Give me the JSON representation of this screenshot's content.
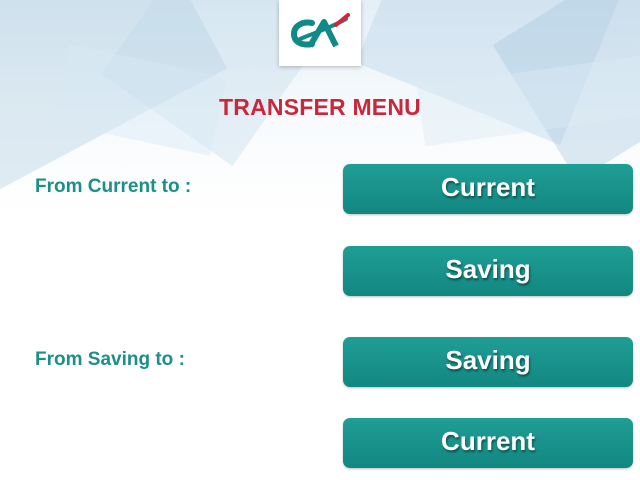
{
  "header": {
    "logo_name": "credit-agricole-logo",
    "title": "TRANSFER MENU"
  },
  "colors": {
    "accent_teal": "#1b8f88",
    "title_red": "#c8283c",
    "button_teal": "#1a958d"
  },
  "sections": [
    {
      "label": "From Current to :",
      "buttons": [
        "Current",
        "Saving"
      ]
    },
    {
      "label": "From Saving to :",
      "buttons": [
        "Saving",
        "Current"
      ]
    }
  ]
}
